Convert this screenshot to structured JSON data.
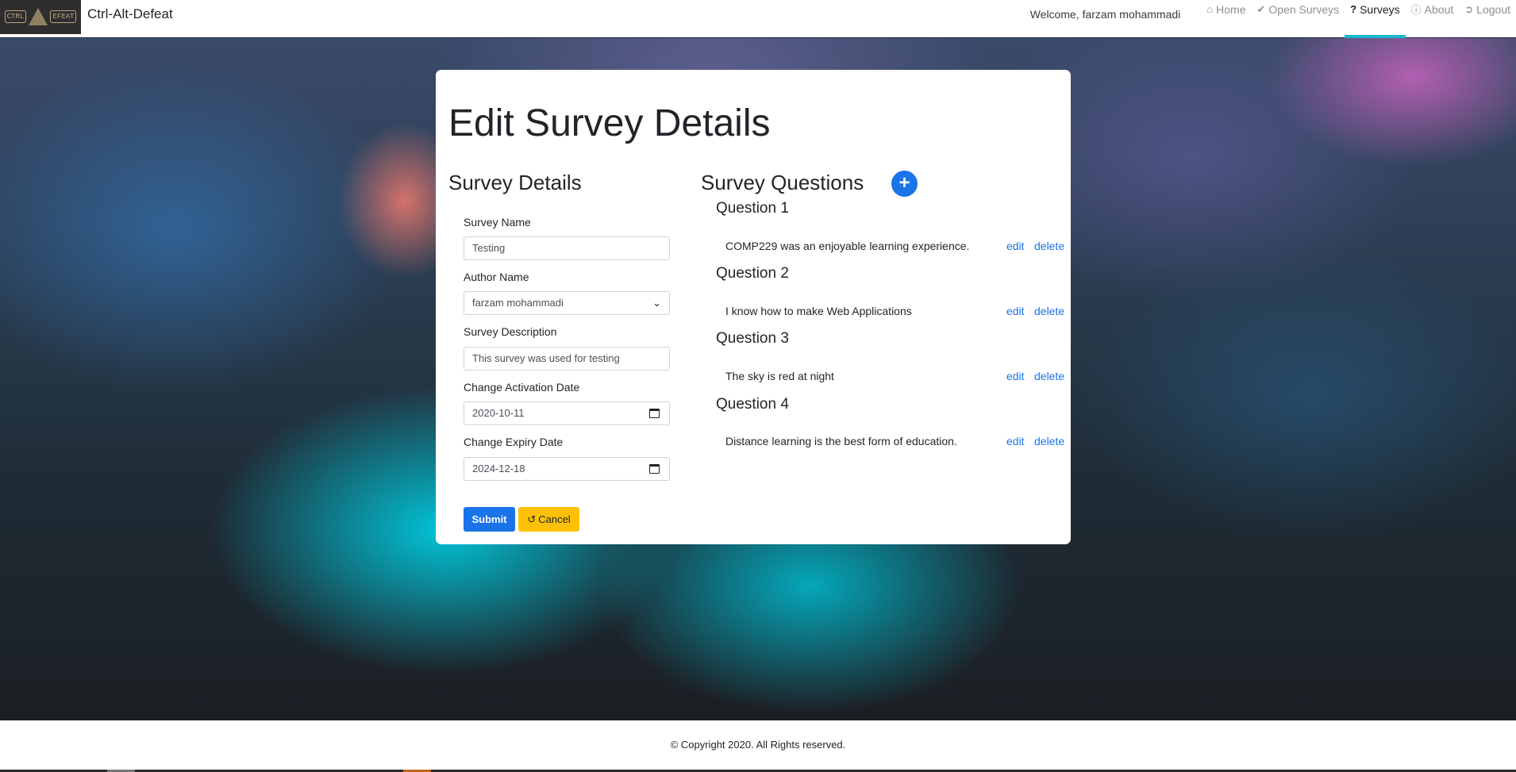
{
  "navbar": {
    "brand": "Ctrl-Alt-Defeat",
    "welcome": "Welcome, farzam mohammadi",
    "items": [
      {
        "label": "Home",
        "icon": "home-icon"
      },
      {
        "label": "Open Surveys",
        "icon": "check-double-icon"
      },
      {
        "label": "Surveys",
        "icon": "question-icon",
        "active": true
      },
      {
        "label": "About",
        "icon": "info-circle-icon"
      },
      {
        "label": "Logout",
        "icon": "logout-icon"
      }
    ]
  },
  "page": {
    "title": "Edit Survey Details"
  },
  "details": {
    "title": "Survey Details",
    "survey_name_label": "Survey Name",
    "survey_name_value": "Testing",
    "author_label": "Author Name",
    "author_value": "farzam mohammadi",
    "description_label": "Survey Description",
    "description_value": "This survey was used for testing",
    "activation_label": "Change Activation Date",
    "activation_value": "2020-10-11",
    "expiry_label": "Change Expiry Date",
    "expiry_value": "2024-12-18",
    "submit_label": "Submit",
    "cancel_label": "Cancel"
  },
  "questions": {
    "title": "Survey Questions",
    "add_label": "+",
    "edit_label": "edit",
    "delete_label": "delete",
    "items": [
      {
        "title": "Question 1",
        "text": "COMP229 was an enjoyable learning experience."
      },
      {
        "title": "Question 2",
        "text": "I know how to make Web Applications"
      },
      {
        "title": "Question 3",
        "text": "The sky is red at night"
      },
      {
        "title": "Question 4",
        "text": "Distance learning is the best form of education."
      }
    ]
  },
  "footer": {
    "text": "© Copyright 2020. All Rights reserved."
  },
  "colors": {
    "primary": "#1a73e8",
    "warning": "#ffc107",
    "active_tab_underline": "#17b8d0"
  }
}
